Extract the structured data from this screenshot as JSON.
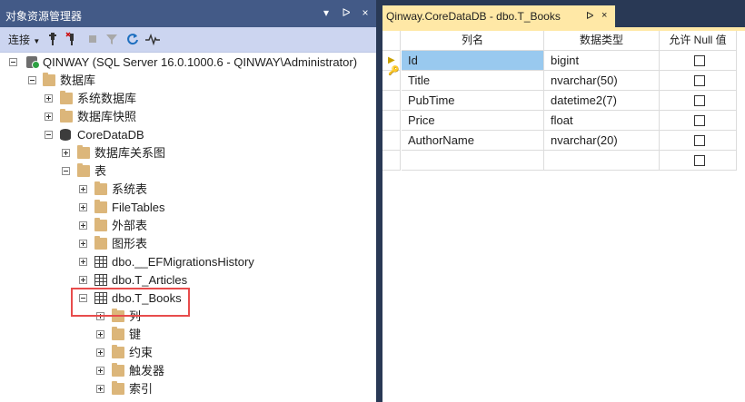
{
  "object_explorer": {
    "title": "对象资源管理器",
    "controls": [
      "▾",
      "ᐅ",
      "×"
    ],
    "toolbar": {
      "connect_label": "连接"
    },
    "tree": [
      {
        "label": "QINWAY (SQL Server 16.0.1000.6 - QINWAY\\Administrator)",
        "icon": "server-icon",
        "expanded": true
      },
      {
        "label": "数据库",
        "icon": "folder-icon",
        "expanded": true
      },
      {
        "label": "系统数据库",
        "icon": "folder-icon",
        "expanded": false
      },
      {
        "label": "数据库快照",
        "icon": "folder-icon",
        "expanded": false
      },
      {
        "label": "CoreDataDB",
        "icon": "database-icon",
        "expanded": true
      },
      {
        "label": "数据库关系图",
        "icon": "folder-icon",
        "expanded": false
      },
      {
        "label": "表",
        "icon": "folder-icon",
        "expanded": true
      },
      {
        "label": "系统表",
        "icon": "folder-icon",
        "expanded": false
      },
      {
        "label": "FileTables",
        "icon": "folder-icon",
        "expanded": false
      },
      {
        "label": "外部表",
        "icon": "folder-icon",
        "expanded": false
      },
      {
        "label": "图形表",
        "icon": "folder-icon",
        "expanded": false
      },
      {
        "label": "dbo.__EFMigrationsHistory",
        "icon": "table-icon",
        "expanded": false
      },
      {
        "label": "dbo.T_Articles",
        "icon": "table-icon",
        "expanded": false
      },
      {
        "label": "dbo.T_Books",
        "icon": "table-icon",
        "expanded": true
      },
      {
        "label": "列",
        "icon": "folder-icon",
        "expanded": false
      },
      {
        "label": "键",
        "icon": "folder-icon",
        "expanded": false
      },
      {
        "label": "约束",
        "icon": "folder-icon",
        "expanded": false
      },
      {
        "label": "触发器",
        "icon": "folder-icon",
        "expanded": false
      },
      {
        "label": "索引",
        "icon": "folder-icon",
        "expanded": false
      }
    ]
  },
  "document": {
    "tab_title": "Qinway.CoreDataDB - dbo.T_Books",
    "tab_pin": "ᐅ",
    "tab_close": "×",
    "grid": {
      "headers": [
        "列名",
        "数据类型",
        "允许 Null 值"
      ],
      "rows": [
        {
          "name": "Id",
          "type": "bigint",
          "allow_null": false,
          "primary_key": true
        },
        {
          "name": "Title",
          "type": "nvarchar(50)",
          "allow_null": false
        },
        {
          "name": "PubTime",
          "type": "datetime2(7)",
          "allow_null": false
        },
        {
          "name": "Price",
          "type": "float",
          "allow_null": false
        },
        {
          "name": "AuthorName",
          "type": "nvarchar(20)",
          "allow_null": false
        },
        {
          "name": "",
          "type": "",
          "allow_null": false
        }
      ]
    }
  },
  "colors": {
    "title_bar": "#435a87",
    "frame": "#293955",
    "tab_active": "#ffe8a6",
    "selection": "#99c9ef",
    "highlight_box": "#e84c4c",
    "folder": "#dcb67a"
  }
}
